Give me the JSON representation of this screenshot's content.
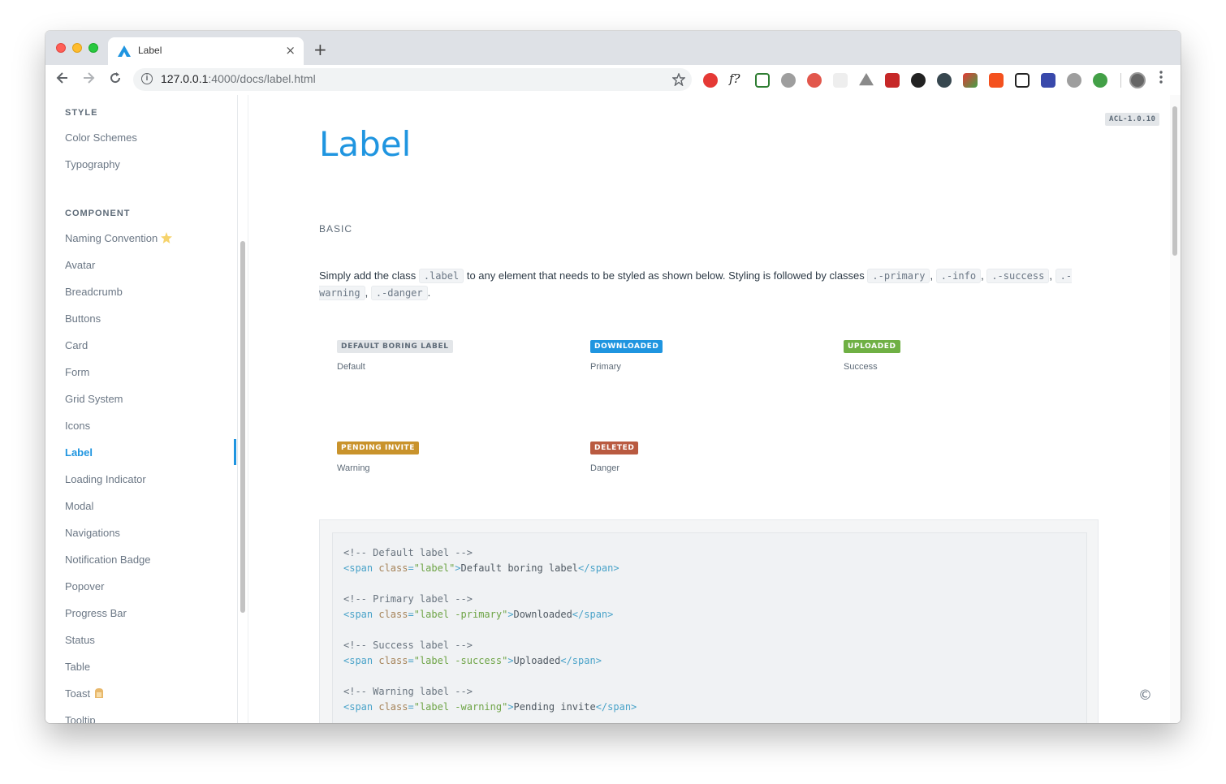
{
  "browser": {
    "tab_title": "Label",
    "tab_close": "×",
    "new_tab": "+",
    "url_host": "127.0.0.1",
    "url_rest": ":4000/docs/label.html",
    "info": "i"
  },
  "sidebar": {
    "style_heading": "STYLE",
    "style_items": [
      "Color Schemes",
      "Typography"
    ],
    "component_heading": "COMPONENT",
    "component_items": [
      "Naming Convention",
      "Avatar",
      "Breadcrumb",
      "Buttons",
      "Card",
      "Form",
      "Grid System",
      "Icons",
      "Label",
      "Loading Indicator",
      "Modal",
      "Navigations",
      "Notification Badge",
      "Popover",
      "Progress Bar",
      "Status",
      "Table",
      "Toast",
      "Tooltip"
    ],
    "active_item": "Label"
  },
  "content": {
    "version": "ACL-1.0.10",
    "title": "Label",
    "section": "BASIC",
    "desc_1": "Simply add the class",
    "desc_code_label": ".label",
    "desc_2": "to any element that needs to be styled as shown below. Styling is followed by classes",
    "desc_code_primary": ".-primary",
    "desc_code_info": ".-info",
    "desc_code_success": ".-success",
    "desc_code_warning": ".-warning",
    "desc_code_danger": ".-danger",
    "comma": ",",
    "period": ".",
    "demos": [
      {
        "label": "DEFAULT BORING LABEL",
        "caption": "Default"
      },
      {
        "label": "DOWNLOADED",
        "caption": "Primary"
      },
      {
        "label": "UPLOADED",
        "caption": "Success"
      },
      {
        "label": "PENDING INVITE",
        "caption": "Warning"
      },
      {
        "label": "DELETED",
        "caption": "Danger"
      }
    ],
    "code": {
      "c1": "<!-- Default label -->",
      "c2": "<!-- Primary label -->",
      "c3": "<!-- Success label -->",
      "c4": "<!-- Warning label -->",
      "open": "<span",
      "class_attr": " class",
      "eq": "=",
      "v1": "\"label\"",
      "v2": "\"label -primary\"",
      "v3": "\"label -success\"",
      "v4": "\"label -warning\"",
      "gt": ">",
      "t1": "Default boring label",
      "t2": "Downloaded",
      "t3": "Uploaded",
      "t4": "Pending invite",
      "close": "</span>"
    },
    "copyright": "©"
  },
  "colors": {
    "accent": "#1f95e0",
    "success": "#6fb044",
    "warning": "#c9932c",
    "danger": "#b95a40",
    "default_bg": "#e3e6e9"
  },
  "icons": [
    "back-icon",
    "forward-icon",
    "reload-icon",
    "info-icon",
    "star-icon",
    "menu-icon"
  ]
}
